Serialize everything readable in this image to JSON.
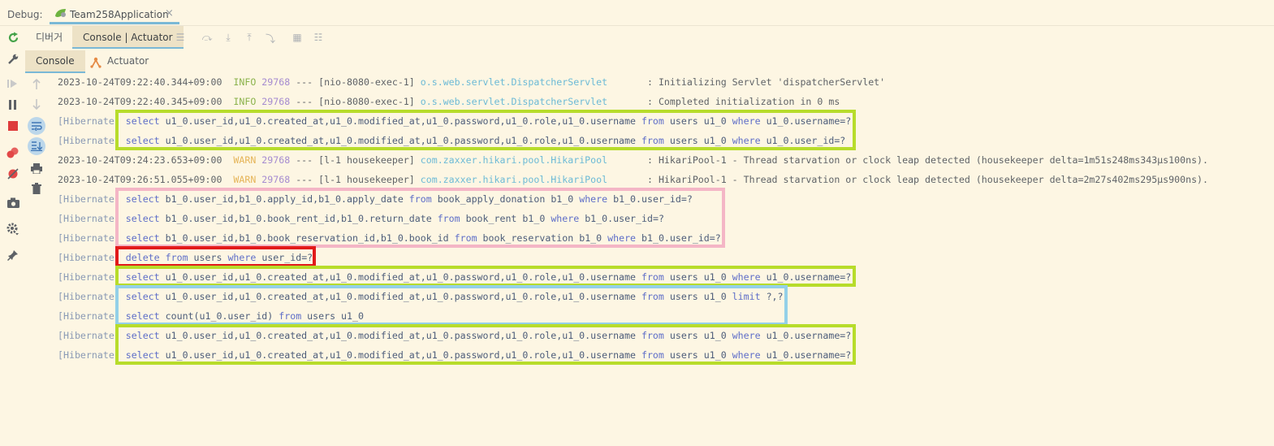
{
  "header": {
    "debug_label": "Debug:",
    "run_tab_name": "Team258Application",
    "close_glyph": "×"
  },
  "tabs": {
    "debugger": "디버거",
    "console_actuator": "Console | Actuator"
  },
  "subtabs": {
    "console": "Console",
    "actuator": "Actuator"
  },
  "log": {
    "lines": [
      {
        "ts": "2023-10-24T09:22:40.344+09:00",
        "level": "INFO",
        "pid": "29768",
        "thread": "--- [nio-8080-exec-1]",
        "logger": "o.s.web.servlet.DispatcherServlet",
        "msg": ": Initializing Servlet 'dispatcherServlet'"
      },
      {
        "ts": "2023-10-24T09:22:40.345+09:00",
        "level": "INFO",
        "pid": "29768",
        "thread": "--- [nio-8080-exec-1]",
        "logger": "o.s.web.servlet.DispatcherServlet",
        "msg": ": Completed initialization in 0 ms"
      },
      {
        "hib": "[Hibernate]",
        "sql": "select u1_0.user_id,u1_0.created_at,u1_0.modified_at,u1_0.password,u1_0.role,u1_0.username from users u1_0 where u1_0.username=?"
      },
      {
        "hib": "[Hibernate]",
        "sql": "select u1_0.user_id,u1_0.created_at,u1_0.modified_at,u1_0.password,u1_0.role,u1_0.username from users u1_0 where u1_0.user_id=?"
      },
      {
        "ts": "2023-10-24T09:24:23.653+09:00",
        "level": "WARN",
        "pid": "29768",
        "thread": "--- [l-1 housekeeper]",
        "logger": "com.zaxxer.hikari.pool.HikariPool",
        "msg": ": HikariPool-1 - Thread starvation or clock leap detected (housekeeper delta=1m51s248ms343µs100ns)."
      },
      {
        "ts": "2023-10-24T09:26:51.055+09:00",
        "level": "WARN",
        "pid": "29768",
        "thread": "--- [l-1 housekeeper]",
        "logger": "com.zaxxer.hikari.pool.HikariPool",
        "msg": ": HikariPool-1 - Thread starvation or clock leap detected (housekeeper delta=2m27s402ms295µs900ns)."
      },
      {
        "hib": "[Hibernate]",
        "sql": "select b1_0.user_id,b1_0.apply_id,b1_0.apply_date from book_apply_donation b1_0 where b1_0.user_id=?"
      },
      {
        "hib": "[Hibernate]",
        "sql": "select b1_0.user_id,b1_0.book_rent_id,b1_0.return_date from book_rent b1_0 where b1_0.user_id=?"
      },
      {
        "hib": "[Hibernate]",
        "sql": "select b1_0.user_id,b1_0.book_reservation_id,b1_0.book_id from book_reservation b1_0 where b1_0.user_id=?"
      },
      {
        "hib": "[Hibernate]",
        "sql": "delete from users where user_id=?"
      },
      {
        "hib": "[Hibernate]",
        "sql": "select u1_0.user_id,u1_0.created_at,u1_0.modified_at,u1_0.password,u1_0.role,u1_0.username from users u1_0 where u1_0.username=?"
      },
      {
        "hib": "[Hibernate]",
        "sql": "select u1_0.user_id,u1_0.created_at,u1_0.modified_at,u1_0.password,u1_0.role,u1_0.username from users u1_0 limit ?,?"
      },
      {
        "hib": "[Hibernate]",
        "sql": "select count(u1_0.user_id) from users u1_0"
      },
      {
        "hib": "[Hibernate]",
        "sql": "select u1_0.user_id,u1_0.created_at,u1_0.modified_at,u1_0.password,u1_0.role,u1_0.username from users u1_0 where u1_0.username=?"
      },
      {
        "hib": "[Hibernate]",
        "sql": "select u1_0.user_id,u1_0.created_at,u1_0.modified_at,u1_0.password,u1_0.role,u1_0.username from users u1_0 where u1_0.username=?"
      }
    ]
  },
  "highlights": [
    {
      "color": "green",
      "first_line": 3,
      "last_line": 4
    },
    {
      "color": "pink",
      "first_line": 7,
      "last_line": 9
    },
    {
      "color": "red",
      "first_line": 10,
      "last_line": 10
    },
    {
      "color": "green",
      "first_line": 11,
      "last_line": 11
    },
    {
      "color": "blue",
      "first_line": 12,
      "last_line": 13
    },
    {
      "color": "green",
      "first_line": 14,
      "last_line": 15
    }
  ],
  "colors": {
    "background": "#fdf6e3",
    "highlight_green": "#b7dc2b",
    "highlight_pink": "#f4b6c6",
    "highlight_red": "#e21a1a",
    "highlight_blue": "#93d0e8"
  },
  "icons": [
    "rerun-icon",
    "settings-wrench-icon",
    "resume-icon",
    "pause-icon",
    "stop-icon",
    "view-breakpoints-icon",
    "mute-breakpoints-icon",
    "camera-icon",
    "gear-icon",
    "pin-icon",
    "up-arrow-icon",
    "down-arrow-icon",
    "soft-wrap-icon",
    "scroll-to-end-icon",
    "print-icon",
    "trash-icon",
    "spring-leaf-icon",
    "actuator-icon"
  ]
}
